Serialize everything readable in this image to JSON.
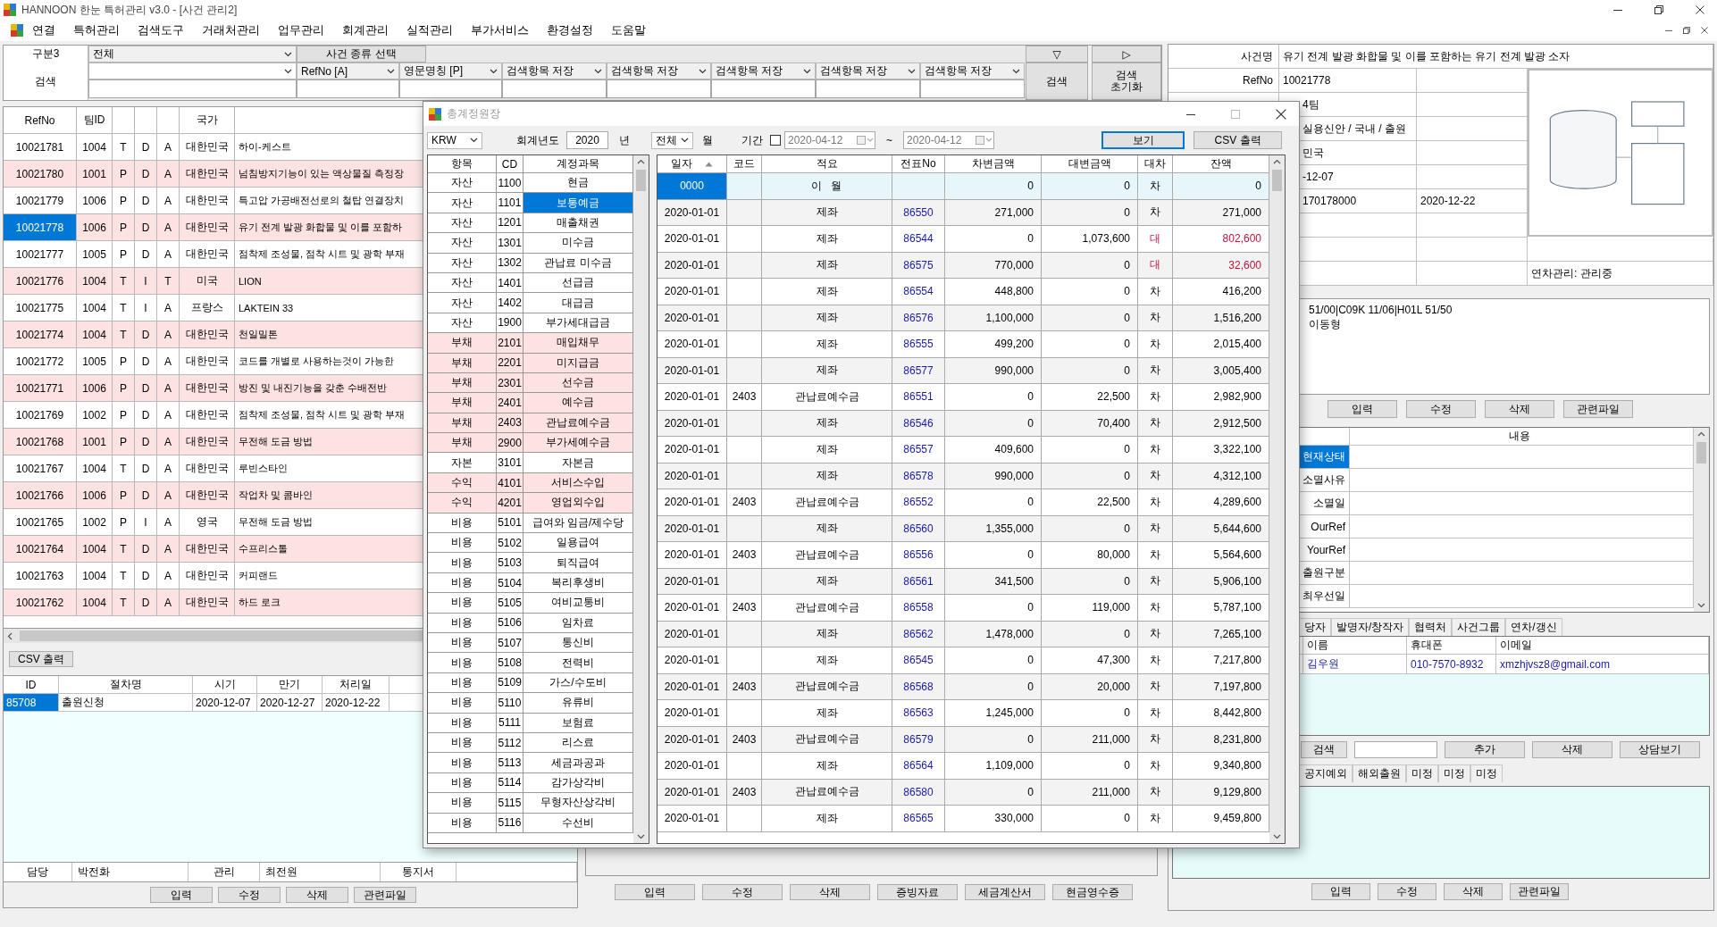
{
  "window": {
    "title": "HANNOON 한눈 특허관리 v3.0 - [사건 관리2]"
  },
  "menu": [
    "연결",
    "특허관리",
    "검색도구",
    "거래처관리",
    "업무관리",
    "회계관리",
    "실적관리",
    "부가서비스",
    "환경설정",
    "도움말"
  ],
  "search": {
    "category_label": "구분3",
    "category": "전체",
    "type_button": "사건 종류 선택",
    "nav_buttons": [
      "▽",
      "▷"
    ],
    "search_label": "검색",
    "fields": [
      "RefNo  [A]",
      "영문명칭  [P]",
      "검색항목 저장",
      "검색항목 저장",
      "검색항목 저장",
      "검색항목 저장",
      "검색항목 저장"
    ],
    "search_button": "검색",
    "reset_button": "검색\n초기화"
  },
  "cases": {
    "columns": {
      "refno": "RefNo",
      "team": "팀ID",
      "country": "국가"
    },
    "rows": [
      {
        "refno": "10021781",
        "team": "1004",
        "column_3": "T",
        "column_4": "D",
        "column_5": "A",
        "country": "대한민국",
        "column_7": "하이-케스트",
        "shaded": false,
        "selected": false
      },
      {
        "refno": "10021780",
        "team": "1001",
        "column_3": "P",
        "column_4": "D",
        "column_5": "A",
        "country": "대한민국",
        "column_7": "넘침방지기능이 있는 액상물질 측정장",
        "shaded": true,
        "selected": false
      },
      {
        "refno": "10021779",
        "team": "1006",
        "column_3": "P",
        "column_4": "D",
        "column_5": "A",
        "country": "대한민국",
        "column_7": "특고압 가공배전선로의 철탑 연결장치",
        "shaded": false,
        "selected": false
      },
      {
        "refno": "10021778",
        "team": "1006",
        "column_3": "P",
        "column_4": "D",
        "column_5": "A",
        "country": "대한민국",
        "column_7": "유기 전계 발광 화합물 및 이를 포함하",
        "shaded": true,
        "selected": true
      },
      {
        "refno": "10021777",
        "team": "1005",
        "column_3": "P",
        "column_4": "D",
        "column_5": "A",
        "country": "대한민국",
        "column_7": "점착제 조성물, 점착 시트 및 광학 부재",
        "shaded": false,
        "selected": false
      },
      {
        "refno": "10021776",
        "team": "1004",
        "column_3": "T",
        "column_4": "I",
        "column_5": "T",
        "country": "미국",
        "column_7": "LION",
        "shaded": true,
        "selected": false
      },
      {
        "refno": "10021775",
        "team": "1004",
        "column_3": "T",
        "column_4": "I",
        "column_5": "A",
        "country": "프랑스",
        "column_7": "LAKTEIN 33",
        "shaded": false,
        "selected": false
      },
      {
        "refno": "10021774",
        "team": "1004",
        "column_3": "T",
        "column_4": "D",
        "column_5": "A",
        "country": "대한민국",
        "column_7": "천일밀톤",
        "shaded": true,
        "selected": false
      },
      {
        "refno": "10021772",
        "team": "1005",
        "column_3": "P",
        "column_4": "D",
        "column_5": "A",
        "country": "대한민국",
        "column_7": "코드를 개별로 사용하는것이 가능한",
        "shaded": false,
        "selected": false
      },
      {
        "refno": "10021771",
        "team": "1006",
        "column_3": "P",
        "column_4": "D",
        "column_5": "A",
        "country": "대한민국",
        "column_7": "방진 및 내진기능을 갖춘 수배전반",
        "shaded": true,
        "selected": false
      },
      {
        "refno": "10021769",
        "team": "1002",
        "column_3": "P",
        "column_4": "D",
        "column_5": "A",
        "country": "대한민국",
        "column_7": "점착제 조성물, 점착 시트 및 광학 부재",
        "shaded": false,
        "selected": false
      },
      {
        "refno": "10021768",
        "team": "1001",
        "column_3": "P",
        "column_4": "D",
        "column_5": "A",
        "country": "대한민국",
        "column_7": "무전해 도금 방법",
        "shaded": true,
        "selected": false
      },
      {
        "refno": "10021767",
        "team": "1004",
        "column_3": "T",
        "column_4": "D",
        "column_5": "A",
        "country": "대한민국",
        "column_7": "루빈스타인",
        "shaded": false,
        "selected": false
      },
      {
        "refno": "10021766",
        "team": "1006",
        "column_3": "P",
        "column_4": "D",
        "column_5": "A",
        "country": "대한민국",
        "column_7": "작업차 및 콤바인",
        "shaded": true,
        "selected": false
      },
      {
        "refno": "10021765",
        "team": "1002",
        "column_3": "P",
        "column_4": "I",
        "column_5": "A",
        "country": "영국",
        "column_7": "무전해 도금 방법",
        "shaded": false,
        "selected": false
      },
      {
        "refno": "10021764",
        "team": "1004",
        "column_3": "T",
        "column_4": "D",
        "column_5": "A",
        "country": "대한민국",
        "column_7": "수프리스톨",
        "shaded": true,
        "selected": false
      },
      {
        "refno": "10021763",
        "team": "1004",
        "column_3": "T",
        "column_4": "D",
        "column_5": "A",
        "country": "대한민국",
        "column_7": "커피랜드",
        "shaded": false,
        "selected": false
      },
      {
        "refno": "10021762",
        "team": "1004",
        "column_3": "T",
        "column_4": "D",
        "column_5": "A",
        "country": "대한민국",
        "column_7": "하드 로크",
        "shaded": true,
        "selected": false
      }
    ]
  },
  "procedures": {
    "csv_button": "CSV 출력",
    "columns": [
      "ID",
      "절차명",
      "시기",
      "만기",
      "처리일"
    ],
    "rows": [
      {
        "cells": [
          "85708",
          "출원신청",
          "2020-12-07",
          "2020-12-27",
          "2020-12-22"
        ],
        "selected": true
      }
    ]
  },
  "staff": [
    {
      "label": "담당",
      "value": "박전화"
    },
    {
      "label": "관리",
      "value": "최전원"
    },
    {
      "label": "통지서"
    }
  ],
  "left_buttons": [
    "입력",
    "수정",
    "삭제",
    "관련파일"
  ],
  "middle_buttons": [
    "입력",
    "수정",
    "삭제",
    "증빙자료",
    "세금계산서",
    "현금영수증"
  ],
  "case_info": {
    "fields": [
      {
        "label": "사건명",
        "value": "유기 전계 발광 화합물 및 이를 포함하는 유기 전계 발광 소자"
      },
      {
        "label": "RefNo",
        "value": "10021778"
      }
    ],
    "rows": [
      [
        "4팀"
      ],
      [
        "실용신안 / 국내 / 출원"
      ],
      [
        "민국"
      ],
      [
        "-12-07"
      ],
      [
        "170178000",
        "2020-12-22"
      ]
    ],
    "annuity": "연차관리: 관리중"
  },
  "notes": [
    "51/00|C09K 11/06|H01L 51/50",
    "이동형"
  ],
  "info_buttons": [
    "입력",
    "수정",
    "삭제",
    "관련파일"
  ],
  "status": {
    "header": "내용",
    "rows": [
      {
        "label": "현재상태",
        "selected": true
      },
      {
        "label": "소멸사유",
        "selected": false
      },
      {
        "label": "소멸일",
        "selected": false
      },
      {
        "label": "OurRef",
        "selected": false
      },
      {
        "label": "YourRef",
        "selected": false
      },
      {
        "label": "출원구분",
        "selected": false
      },
      {
        "label": "최우선일",
        "selected": false
      }
    ]
  },
  "contact_tabs": [
    "당자",
    "발명자/창작자",
    "협력처",
    "사건그룹",
    "연차/갱신"
  ],
  "contacts": {
    "columns": [
      "이름",
      "휴대폰",
      "이메일"
    ],
    "rows": [
      [
        "김우원",
        "010-7570-8932",
        "xmzhjvsz8@gmail.com"
      ]
    ]
  },
  "contact_actions": {
    "search_button": "검색",
    "buttons": [
      "추가",
      "삭제",
      "상담보기"
    ]
  },
  "extra_tabs": [
    "공지예외",
    "해외출원",
    "미정",
    "미정",
    "미정"
  ],
  "right_buttons": [
    "입력",
    "수정",
    "삭제",
    "관련파일"
  ],
  "ledger": {
    "title": "총계정원장",
    "currency": "KRW",
    "year_label": "회계년도",
    "year": "2020",
    "year_unit": "년",
    "month": "전체",
    "month_unit": "월",
    "period_label": "기간",
    "period_checked": false,
    "date_from": "2020-04-12",
    "tilde": "~",
    "date_to": "2020-04-12",
    "buttons": [
      {
        "label": "보기",
        "selected": true
      },
      {
        "label": "CSV 출력",
        "selected": false
      }
    ],
    "accounts": {
      "columns": [
        "항목",
        "CD",
        "계정과목"
      ],
      "rows": [
        {
          "group": "자산",
          "code": "1100",
          "name": "현금",
          "shaded": false,
          "selected": false
        },
        {
          "group": "자산",
          "code": "1101",
          "name": "보통예금",
          "shaded": false,
          "selected": true
        },
        {
          "group": "자산",
          "code": "1201",
          "name": "매출채권",
          "shaded": false,
          "selected": false
        },
        {
          "group": "자산",
          "code": "1301",
          "name": "미수금",
          "shaded": false,
          "selected": false
        },
        {
          "group": "자산",
          "code": "1302",
          "name": "관납료 미수금",
          "shaded": false,
          "selected": false
        },
        {
          "group": "자산",
          "code": "1401",
          "name": "선급금",
          "shaded": false,
          "selected": false
        },
        {
          "group": "자산",
          "code": "1402",
          "name": "대급금",
          "shaded": false,
          "selected": false
        },
        {
          "group": "자산",
          "code": "1900",
          "name": "부가세대급금",
          "shaded": false,
          "selected": false
        },
        {
          "group": "부채",
          "code": "2101",
          "name": "매입채무",
          "shaded": true,
          "selected": false
        },
        {
          "group": "부채",
          "code": "2201",
          "name": "미지급금",
          "shaded": true,
          "selected": false
        },
        {
          "group": "부채",
          "code": "2301",
          "name": "선수금",
          "shaded": true,
          "selected": false
        },
        {
          "group": "부채",
          "code": "2401",
          "name": "예수금",
          "shaded": true,
          "selected": false
        },
        {
          "group": "부채",
          "code": "2403",
          "name": "관납료예수금",
          "shaded": true,
          "selected": false
        },
        {
          "group": "부채",
          "code": "2900",
          "name": "부가세예수금",
          "shaded": true,
          "selected": false
        },
        {
          "group": "자본",
          "code": "3101",
          "name": "자본금",
          "shaded": false,
          "selected": false
        },
        {
          "group": "수익",
          "code": "4101",
          "name": "서비스수입",
          "shaded": true,
          "selected": false
        },
        {
          "group": "수익",
          "code": "4201",
          "name": "영업외수입",
          "shaded": true,
          "selected": false
        },
        {
          "group": "비용",
          "code": "5101",
          "name": "급여와 임금/제수당",
          "shaded": false,
          "selected": false
        },
        {
          "group": "비용",
          "code": "5102",
          "name": "일용급여",
          "shaded": false,
          "selected": false
        },
        {
          "group": "비용",
          "code": "5103",
          "name": "퇴직급여",
          "shaded": false,
          "selected": false
        },
        {
          "group": "비용",
          "code": "5104",
          "name": "복리후생비",
          "shaded": false,
          "selected": false
        },
        {
          "group": "비용",
          "code": "5105",
          "name": "여비교통비",
          "shaded": false,
          "selected": false
        },
        {
          "group": "비용",
          "code": "5106",
          "name": "임차료",
          "shaded": false,
          "selected": false
        },
        {
          "group": "비용",
          "code": "5107",
          "name": "통신비",
          "shaded": false,
          "selected": false
        },
        {
          "group": "비용",
          "code": "5108",
          "name": "전력비",
          "shaded": false,
          "selected": false
        },
        {
          "group": "비용",
          "code": "5109",
          "name": "가스/수도비",
          "shaded": false,
          "selected": false
        },
        {
          "group": "비용",
          "code": "5110",
          "name": "유류비",
          "shaded": false,
          "selected": false
        },
        {
          "group": "비용",
          "code": "5111",
          "name": "보험료",
          "shaded": false,
          "selected": false
        },
        {
          "group": "비용",
          "code": "5112",
          "name": "리스료",
          "shaded": false,
          "selected": false
        },
        {
          "group": "비용",
          "code": "5113",
          "name": "세금과공과",
          "shaded": false,
          "selected": false
        },
        {
          "group": "비용",
          "code": "5114",
          "name": "감가상각비",
          "shaded": false,
          "selected": false
        },
        {
          "group": "비용",
          "code": "5115",
          "name": "무형자산상각비",
          "shaded": false,
          "selected": false
        },
        {
          "group": "비용",
          "code": "5116",
          "name": "수선비",
          "shaded": false,
          "selected": false
        }
      ]
    },
    "entries": {
      "columns": [
        "일자",
        "코드",
        "적요",
        "전표No",
        "차변금액",
        "대변금액",
        "대차",
        "잔액"
      ],
      "rows": [
        {
          "date": "0000",
          "memo": "이   월",
          "debit": "0",
          "credit": "0",
          "side": "차",
          "balance": "0",
          "kind": "carryover",
          "selected": true
        },
        {
          "date": "2020-01-01",
          "memo": "제좌",
          "voucher": "86550",
          "debit": "271,000",
          "credit": "0",
          "side": "차",
          "balance": "271,000",
          "kind": "debit",
          "selected": false
        },
        {
          "date": "2020-01-01",
          "memo": "제좌",
          "voucher": "86544",
          "debit": "0",
          "credit": "1,073,600",
          "side": "대",
          "balance": "802,600",
          "kind": "credit",
          "selected": false
        },
        {
          "date": "2020-01-01",
          "memo": "제좌",
          "voucher": "86575",
          "debit": "770,000",
          "credit": "0",
          "side": "대",
          "balance": "32,600",
          "kind": "credit",
          "selected": false
        },
        {
          "date": "2020-01-01",
          "memo": "제좌",
          "voucher": "86554",
          "debit": "448,800",
          "credit": "0",
          "side": "차",
          "balance": "416,200",
          "kind": "debit",
          "selected": false
        },
        {
          "date": "2020-01-01",
          "memo": "제좌",
          "voucher": "86576",
          "debit": "1,100,000",
          "credit": "0",
          "side": "차",
          "balance": "1,516,200",
          "kind": "debit",
          "selected": false
        },
        {
          "date": "2020-01-01",
          "memo": "제좌",
          "voucher": "86555",
          "debit": "499,200",
          "credit": "0",
          "side": "차",
          "balance": "2,015,400",
          "kind": "debit",
          "selected": false
        },
        {
          "date": "2020-01-01",
          "memo": "제좌",
          "voucher": "86577",
          "debit": "990,000",
          "credit": "0",
          "side": "차",
          "balance": "3,005,400",
          "kind": "debit",
          "selected": false
        },
        {
          "date": "2020-01-01",
          "code": "2403",
          "memo": "관납료예수금",
          "voucher": "86551",
          "debit": "0",
          "credit": "22,500",
          "side": "차",
          "balance": "2,982,900",
          "kind": "debit",
          "selected": false
        },
        {
          "date": "2020-01-01",
          "memo": "제좌",
          "voucher": "86546",
          "debit": "0",
          "credit": "70,400",
          "side": "차",
          "balance": "2,912,500",
          "kind": "debit",
          "selected": false
        },
        {
          "date": "2020-01-01",
          "memo": "제좌",
          "voucher": "86557",
          "debit": "409,600",
          "credit": "0",
          "side": "차",
          "balance": "3,322,100",
          "kind": "debit",
          "selected": false
        },
        {
          "date": "2020-01-01",
          "memo": "제좌",
          "voucher": "86578",
          "debit": "990,000",
          "credit": "0",
          "side": "차",
          "balance": "4,312,100",
          "kind": "debit",
          "selected": false
        },
        {
          "date": "2020-01-01",
          "code": "2403",
          "memo": "관납료예수금",
          "voucher": "86552",
          "debit": "0",
          "credit": "22,500",
          "side": "차",
          "balance": "4,289,600",
          "kind": "debit",
          "selected": false
        },
        {
          "date": "2020-01-01",
          "memo": "제좌",
          "voucher": "86560",
          "debit": "1,355,000",
          "credit": "0",
          "side": "차",
          "balance": "5,644,600",
          "kind": "debit",
          "selected": false
        },
        {
          "date": "2020-01-01",
          "code": "2403",
          "memo": "관납료예수금",
          "voucher": "86556",
          "debit": "0",
          "credit": "80,000",
          "side": "차",
          "balance": "5,564,600",
          "kind": "debit",
          "selected": false
        },
        {
          "date": "2020-01-01",
          "memo": "제좌",
          "voucher": "86561",
          "debit": "341,500",
          "credit": "0",
          "side": "차",
          "balance": "5,906,100",
          "kind": "debit",
          "selected": false
        },
        {
          "date": "2020-01-01",
          "code": "2403",
          "memo": "관납료예수금",
          "voucher": "86558",
          "debit": "0",
          "credit": "119,000",
          "side": "차",
          "balance": "5,787,100",
          "kind": "debit",
          "selected": false
        },
        {
          "date": "2020-01-01",
          "memo": "제좌",
          "voucher": "86562",
          "debit": "1,478,000",
          "credit": "0",
          "side": "차",
          "balance": "7,265,100",
          "kind": "debit",
          "selected": false
        },
        {
          "date": "2020-01-01",
          "memo": "제좌",
          "voucher": "86545",
          "debit": "0",
          "credit": "47,300",
          "side": "차",
          "balance": "7,217,800",
          "kind": "debit",
          "selected": false
        },
        {
          "date": "2020-01-01",
          "code": "2403",
          "memo": "관납료예수금",
          "voucher": "86568",
          "debit": "0",
          "credit": "20,000",
          "side": "차",
          "balance": "7,197,800",
          "kind": "debit",
          "selected": false
        },
        {
          "date": "2020-01-01",
          "memo": "제좌",
          "voucher": "86563",
          "debit": "1,245,000",
          "credit": "0",
          "side": "차",
          "balance": "8,442,800",
          "kind": "debit",
          "selected": false
        },
        {
          "date": "2020-01-01",
          "code": "2403",
          "memo": "관납료예수금",
          "voucher": "86579",
          "debit": "0",
          "credit": "211,000",
          "side": "차",
          "balance": "8,231,800",
          "kind": "debit",
          "selected": false
        },
        {
          "date": "2020-01-01",
          "memo": "제좌",
          "voucher": "86564",
          "debit": "1,109,000",
          "credit": "0",
          "side": "차",
          "balance": "9,340,800",
          "kind": "debit",
          "selected": false
        },
        {
          "date": "2020-01-01",
          "code": "2403",
          "memo": "관납료예수금",
          "voucher": "86580",
          "debit": "0",
          "credit": "211,000",
          "side": "차",
          "balance": "9,129,800",
          "kind": "debit",
          "selected": false
        },
        {
          "date": "2020-01-01",
          "memo": "제좌",
          "voucher": "86565",
          "debit": "330,000",
          "credit": "0",
          "side": "차",
          "balance": "9,459,800",
          "kind": "debit",
          "selected": false
        }
      ]
    }
  }
}
